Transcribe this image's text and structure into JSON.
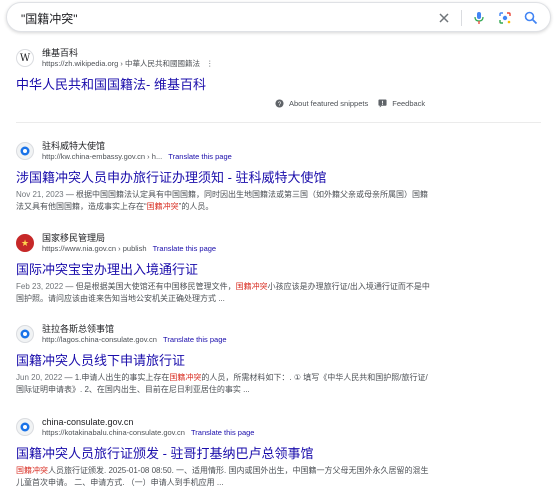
{
  "search": {
    "query": "\"国籍冲突\""
  },
  "featured": {
    "site_name": "维基百科",
    "url": "https://zh.wikipedia.org",
    "breadcrumb": "› 中華人民共和國國籍法",
    "title": "中华人民共和国国籍法- 维基百科",
    "about_label": "About featured snippets",
    "feedback_label": "Feedback"
  },
  "results": [
    {
      "site_name": "驻科威特大使馆",
      "url": "http://kw.china-embassy.gov.cn › h...",
      "translate": "Translate this page",
      "title": "涉国籍冲突人员申办旅行证办理须知 - 驻科威特大使馆",
      "date": "Nov 21, 2023",
      "snippet_pre": " — 根据中国国籍法认定具有中国国籍，同时因出生地国籍法或第三国（如外籍父亲或母亲所属国）国籍法又具有他国国籍，造成事实上存在“",
      "snippet_hl": "国籍冲突",
      "snippet_post": "”的人员。"
    },
    {
      "site_name": "国家移民管理局",
      "url": "https://www.nia.gov.cn › publish",
      "translate": "Translate this page",
      "title": "国际冲突宝宝办理出入境通行证",
      "date": "Feb 23, 2022",
      "snippet_pre": " — 但是根据美国大使馆还有中国移民管理文件，",
      "snippet_hl": "国籍冲突",
      "snippet_post": "小孩应该是办理旅行证/出入境通行证而不是中国护照。请问应该由谁来告知当地公安机关正确处理方式 ..."
    },
    {
      "site_name": "驻拉各斯总领事馆",
      "url": "http://lagos.china-consulate.gov.cn",
      "translate": "Translate this page",
      "title": "国籍冲突人员线下申请旅行证",
      "date": "Jun 20, 2022",
      "snippet_pre": " — 1.申请人出生的事实上存在",
      "snippet_hl": "国籍冲突",
      "snippet_post": "的人员，所需材料如下：. ① 填写《中华人民共和国护照/旅行证/国际证明申请表》. 2、在国内出生、目前在尼日利亚居住的事实 ..."
    },
    {
      "site_name": "china-consulate.gov.cn",
      "url": "https://kotakinabalu.china-consulate.gov.cn",
      "translate": "Translate this page",
      "title": "国籍冲突人员旅行证颁发 - 驻哥打基纳巴卢总领事馆",
      "date": "",
      "snippet_pre": "",
      "snippet_hl": "国籍冲突",
      "snippet_post": "人员旅行证颁发. 2025-01-08 08:50. 一、适用情形. 国内或国外出生，中国籍一方父母无国外永久居留的混生儿童首次申请。 二、申请方式. （一）申请人到手机应用 ..."
    }
  ],
  "icons": {
    "clear": "close-icon",
    "voice": "mic-icon",
    "lens": "lens-icon",
    "search": "search-icon"
  },
  "colors": {
    "link": "#1a0dab",
    "highlight": "#d93025",
    "text": "#202124",
    "snippet": "#4d5156"
  }
}
